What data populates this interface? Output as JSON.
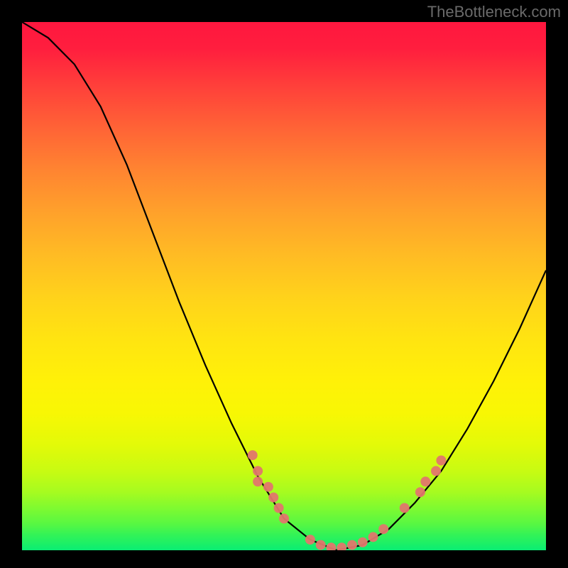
{
  "attribution": "TheBottleneck.com",
  "chart_data": {
    "type": "line",
    "title": "",
    "xlabel": "",
    "ylabel": "",
    "xlim": [
      0,
      100
    ],
    "ylim": [
      0,
      100
    ],
    "grid": false,
    "curve": [
      {
        "x": 0,
        "y": 100
      },
      {
        "x": 5,
        "y": 97
      },
      {
        "x": 10,
        "y": 92
      },
      {
        "x": 15,
        "y": 84
      },
      {
        "x": 20,
        "y": 73
      },
      {
        "x": 25,
        "y": 60
      },
      {
        "x": 30,
        "y": 47
      },
      {
        "x": 35,
        "y": 35
      },
      {
        "x": 40,
        "y": 24
      },
      {
        "x": 45,
        "y": 14
      },
      {
        "x": 50,
        "y": 6
      },
      {
        "x": 55,
        "y": 2
      },
      {
        "x": 60,
        "y": 0
      },
      {
        "x": 65,
        "y": 1
      },
      {
        "x": 70,
        "y": 4
      },
      {
        "x": 75,
        "y": 9
      },
      {
        "x": 80,
        "y": 15
      },
      {
        "x": 85,
        "y": 23
      },
      {
        "x": 90,
        "y": 32
      },
      {
        "x": 95,
        "y": 42
      },
      {
        "x": 100,
        "y": 53
      }
    ],
    "points": [
      {
        "x": 44,
        "y": 18,
        "label": ""
      },
      {
        "x": 45,
        "y": 15,
        "label": ""
      },
      {
        "x": 45,
        "y": 13,
        "label": ""
      },
      {
        "x": 47,
        "y": 12,
        "label": ""
      },
      {
        "x": 48,
        "y": 10,
        "label": ""
      },
      {
        "x": 49,
        "y": 8,
        "label": ""
      },
      {
        "x": 50,
        "y": 6,
        "label": ""
      },
      {
        "x": 55,
        "y": 2,
        "label": ""
      },
      {
        "x": 57,
        "y": 1,
        "label": ""
      },
      {
        "x": 59,
        "y": 0.5,
        "label": ""
      },
      {
        "x": 61,
        "y": 0.5,
        "label": ""
      },
      {
        "x": 63,
        "y": 1,
        "label": ""
      },
      {
        "x": 65,
        "y": 1.5,
        "label": ""
      },
      {
        "x": 67,
        "y": 2.5,
        "label": ""
      },
      {
        "x": 69,
        "y": 4,
        "label": ""
      },
      {
        "x": 73,
        "y": 8,
        "label": ""
      },
      {
        "x": 76,
        "y": 11,
        "label": ""
      },
      {
        "x": 77,
        "y": 13,
        "label": ""
      },
      {
        "x": 79,
        "y": 15,
        "label": ""
      },
      {
        "x": 80,
        "y": 17,
        "label": ""
      }
    ],
    "point_color": "#e2766d",
    "line_color": "#000000"
  }
}
